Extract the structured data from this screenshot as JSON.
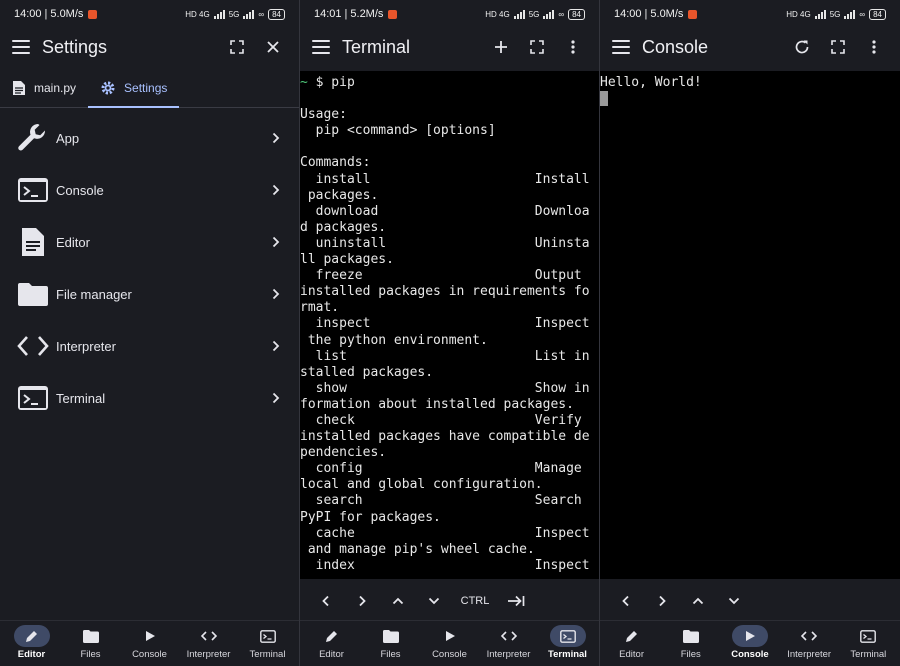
{
  "screens": [
    {
      "status": {
        "time": "14:00",
        "speed": "5.0M/s",
        "net": "HD 4G",
        "net2": "5G",
        "battery": "84"
      },
      "appbar": {
        "title": "Settings"
      },
      "tabs": [
        {
          "label": "main.py"
        },
        {
          "label": "Settings"
        }
      ],
      "settings": [
        {
          "label": "App",
          "icon": "wrench-icon"
        },
        {
          "label": "Console",
          "icon": "console-icon"
        },
        {
          "label": "Editor",
          "icon": "document-icon"
        },
        {
          "label": "File manager",
          "icon": "folder-icon"
        },
        {
          "label": "Interpreter",
          "icon": "code-icon"
        },
        {
          "label": "Terminal",
          "icon": "terminal-icon"
        }
      ],
      "nav": [
        {
          "label": "Editor"
        },
        {
          "label": "Files"
        },
        {
          "label": "Console"
        },
        {
          "label": "Interpreter"
        },
        {
          "label": "Terminal"
        }
      ],
      "nav_active": "Editor"
    },
    {
      "status": {
        "time": "14:01",
        "speed": "5.2M/s",
        "net": "HD 4G",
        "net2": "5G",
        "battery": "84"
      },
      "appbar": {
        "title": "Terminal"
      },
      "terminal": {
        "prompt_symbol": "~",
        "command": " $ pip",
        "output": [
          "",
          "Usage:",
          "  pip <command> [options]",
          "",
          "Commands:",
          "  install                     Install",
          " packages.",
          "  download                    Downloa",
          "d packages.",
          "  uninstall                   Uninsta",
          "ll packages.",
          "  freeze                      Output ",
          "installed packages in requirements fo",
          "rmat.",
          "  inspect                     Inspect",
          " the python environment.",
          "  list                        List in",
          "stalled packages.",
          "  show                        Show in",
          "formation about installed packages.",
          "  check                       Verify ",
          "installed packages have compatible de",
          "pendencies.",
          "  config                      Manage ",
          "local and global configuration.",
          "  search                      Search ",
          "PyPI for packages.",
          "  cache                       Inspect",
          " and manage pip's wheel cache.",
          "  index                       Inspect"
        ]
      },
      "keys": {
        "ctrl": "CTRL"
      },
      "nav": [
        {
          "label": "Editor"
        },
        {
          "label": "Files"
        },
        {
          "label": "Console"
        },
        {
          "label": "Interpreter"
        },
        {
          "label": "Terminal"
        }
      ],
      "nav_active": "Terminal"
    },
    {
      "status": {
        "time": "14:00",
        "speed": "5.0M/s",
        "net": "HD 4G",
        "net2": "5G",
        "battery": "84"
      },
      "appbar": {
        "title": "Console"
      },
      "console": {
        "output": "Hello, World!"
      },
      "nav": [
        {
          "label": "Editor"
        },
        {
          "label": "Files"
        },
        {
          "label": "Console"
        },
        {
          "label": "Interpreter"
        },
        {
          "label": "Terminal"
        }
      ],
      "nav_active": "Console"
    }
  ]
}
